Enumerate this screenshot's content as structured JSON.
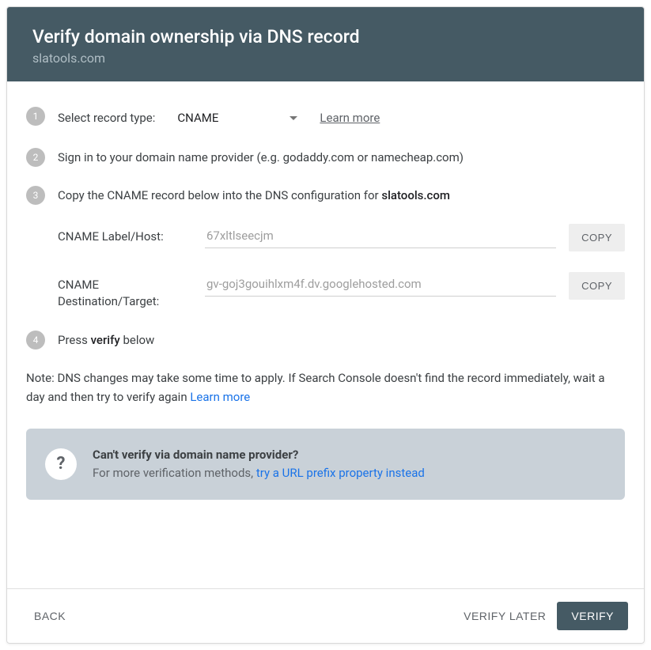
{
  "header": {
    "title": "Verify domain ownership via DNS record",
    "domain": "slatools.com"
  },
  "steps": {
    "s1": {
      "num": "1",
      "label": "Select record type:",
      "select_value": "CNAME",
      "learn_more": "Learn more"
    },
    "s2": {
      "num": "2",
      "text": "Sign in to your domain name provider (e.g. godaddy.com or namecheap.com)"
    },
    "s3": {
      "num": "3",
      "text_a": "Copy the CNAME record below into the DNS configuration for ",
      "domain": "slatools.com",
      "fields": {
        "label_host_label": "CNAME Label/Host:",
        "label_host_value": "67xltlseecjm",
        "dest_label": "CNAME Destination/Target:",
        "dest_value": "gv-goj3gouihlxm4f.dv.googlehosted.com",
        "copy": "COPY"
      }
    },
    "s4": {
      "num": "4",
      "text_a": "Press ",
      "verify": "verify",
      "text_b": " below"
    }
  },
  "note": {
    "text": "Note: DNS changes may take some time to apply. If Search Console doesn't find the record immediately, wait a day and then try to verify again ",
    "link": "Learn more"
  },
  "info": {
    "title": "Can't verify via domain name provider?",
    "sub": "For more verification methods, ",
    "link": "try a URL prefix property instead"
  },
  "footer": {
    "back": "BACK",
    "later": "VERIFY LATER",
    "verify": "VERIFY"
  }
}
